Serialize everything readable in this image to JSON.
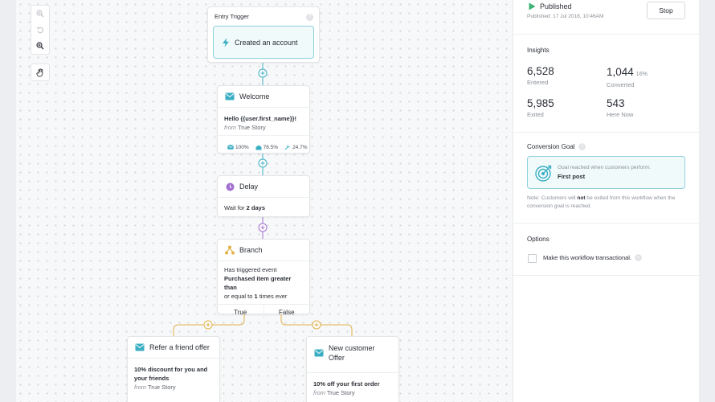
{
  "toolbar": {
    "icons": [
      "zoom-in-icon",
      "undo-icon",
      "zoom-out-icon",
      "hand-icon"
    ]
  },
  "trigger": {
    "label": "Entry Trigger",
    "help": "?",
    "event": "Created an account"
  },
  "nodes": {
    "welcome": {
      "title": "Welcome",
      "subject": "Hello {{user.first_name}}!",
      "from_prefix": "from",
      "from": "True Story",
      "stats": [
        "100%",
        "76.5%",
        "24.7%"
      ]
    },
    "delay": {
      "title": "Delay",
      "text": "Wait for",
      "value": "2 days"
    },
    "branch": {
      "title": "Branch",
      "line1": "Has triggered event",
      "line2": "Purchased item greater than",
      "line3a": "or equal to",
      "line3b": "1",
      "line3c": "times",
      "line3d": "ever",
      "true_label": "True",
      "false_label": "False"
    },
    "refer": {
      "title": "Refer a friend offer",
      "line1": "10% discount for you and",
      "line2": "your friends",
      "from_prefix": "from",
      "from": "True Story"
    },
    "newcust": {
      "title_line1": "New customer",
      "title_line2": "Offer",
      "line1": "10% off your first order",
      "from_prefix": "from",
      "from": "True Story"
    }
  },
  "panel": {
    "status": "Published",
    "published_date": "Published: 17 Jul 2018, 10:46AM",
    "stop_label": "Stop",
    "insights_title": "Insights",
    "metrics": {
      "entered": {
        "value": "6,528",
        "label": "Entered"
      },
      "converted": {
        "value": "1,044",
        "pct": "16%",
        "label": "Converted"
      },
      "exited": {
        "value": "5,985",
        "label": "Exited"
      },
      "here_now": {
        "value": "543",
        "label": "Here Now"
      }
    },
    "goal_title": "Conversion Goal",
    "goal_caption": "Goal reached when customers perform:",
    "goal_event": "First post",
    "note_pre": "Note: Customers will",
    "note_bold": "not",
    "note_post": "be exited from this workflow when the conversion goal is reached.",
    "options_title": "Options",
    "transactional_label": "Make this workflow transactional."
  },
  "colors": {
    "teal": "#3aaec3",
    "purple": "#a36fd0",
    "gold": "#e1b24a",
    "green": "#3cb371"
  }
}
